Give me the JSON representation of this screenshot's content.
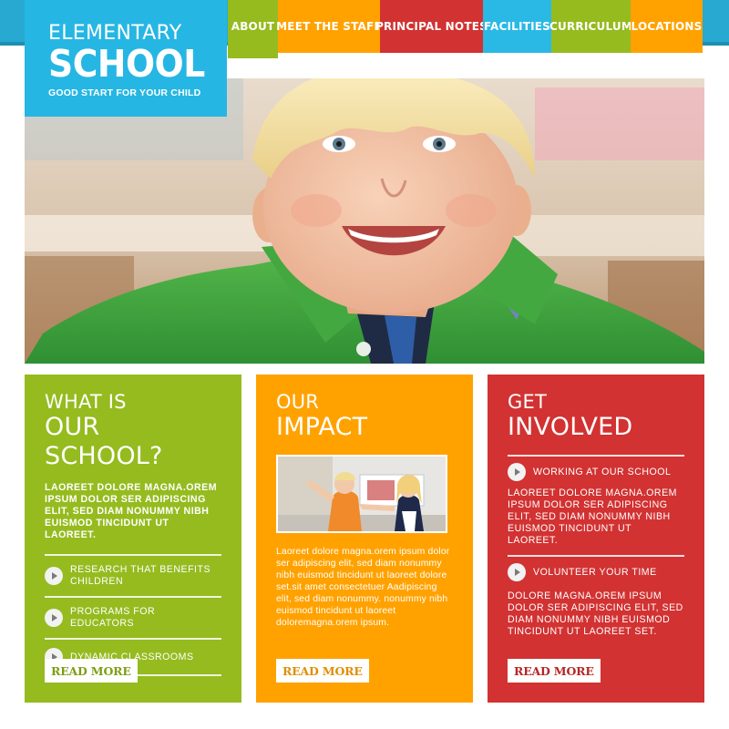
{
  "colors": {
    "topbar": "#27a9d1",
    "logo_bg": "#26b6e3",
    "green": "#95bb1f",
    "orange": "#ffa200",
    "red": "#d23232",
    "nav_blue": "#2ab9e5",
    "button_text_green": "#7d9e12",
    "button_text_orange": "#e08e00",
    "button_text_red": "#b82525"
  },
  "logo": {
    "line1": "ELEMENTARY",
    "line2": "SCHOOL",
    "tagline": "GOOD START FOR YOUR CHILD"
  },
  "nav": [
    {
      "label": "ABOUT"
    },
    {
      "label": "MEET THE STAFF"
    },
    {
      "label": "PRINCIPAL NOTES"
    },
    {
      "label": "FACILITIES"
    },
    {
      "label": "CURRICULUM"
    },
    {
      "label": "LOCATIONS"
    }
  ],
  "panels": {
    "school": {
      "title_small": "WHAT IS",
      "title_big": "OUR SCHOOL?",
      "intro": "LAOREET DOLORE MAGNA.OREM IPSUM DOLOR SER ADIPISCING ELIT, SED DIAM NONUMMY NIBH EUISMOD TINCIDUNT UT LAOREET.",
      "links": [
        {
          "label": "RESEARCH THAT BENEFITS CHILDREN"
        },
        {
          "label": "PROGRAMS FOR EDUCATORS"
        },
        {
          "label": "DYNAMIC CLASSROOMS"
        }
      ],
      "button": "READ MORE"
    },
    "impact": {
      "title_small": "OUR",
      "title_big": "IMPACT",
      "body": "Laoreet dolore magna.orem ipsum dolor ser adipiscing elit, sed diam nonummy nibh euismod tincidunt ut laoreet dolore set.sit amet consectetuer Aadipiscing elit, sed diam nonummy. nonummy nibh euismod tincidunt ut laoreet doloremagna.orem ipsum.",
      "button": "READ MORE"
    },
    "involved": {
      "title_small": "GET",
      "title_big": "INVOLVED",
      "sections": [
        {
          "heading": "WORKING AT OUR SCHOOL",
          "text": "LAOREET DOLORE MAGNA.OREM IPSUM DOLOR SER ADIPISCING ELIT, SED DIAM NONUMMY NIBH EUISMOD TINCIDUNT UT LAOREET."
        },
        {
          "heading": "VOLUNTEER YOUR TIME",
          "text": "DOLORE MAGNA.OREM IPSUM DOLOR SER ADIPISCING ELIT, SED DIAM NONUMMY NIBH EUISMOD TINCIDUNT UT LAOREET SET."
        }
      ],
      "button": "READ MORE"
    }
  }
}
